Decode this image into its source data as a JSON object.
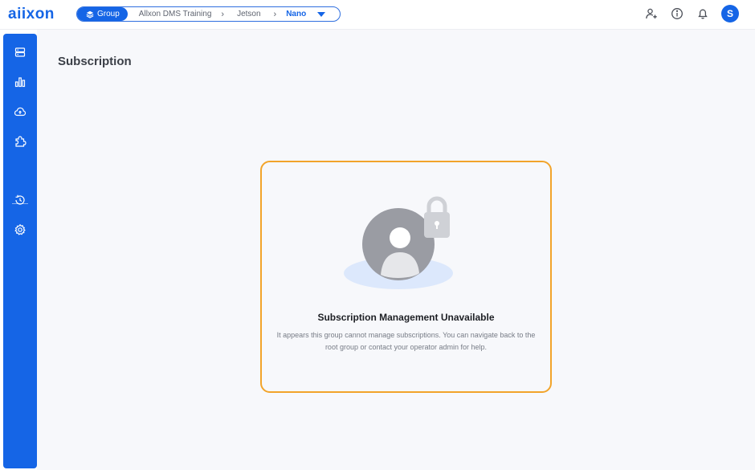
{
  "header": {
    "logo": "aiixon",
    "breadcrumb": {
      "group_label": "Group",
      "items": [
        "Allxon DMS Training",
        "Jetson"
      ],
      "active": "Nano"
    },
    "avatar_initial": "S"
  },
  "sidebar": {
    "items": [
      "devices-icon",
      "dashboard-icon",
      "ota-icon",
      "plugins-icon",
      "alerts-icon",
      "settings-icon"
    ]
  },
  "main": {
    "page_title": "Subscription",
    "empty_state": {
      "title": "Subscription Management Unavailable",
      "description": "It appears this group cannot manage subscriptions. You can navigate back to the root group or contact your operator admin for help."
    }
  },
  "colors": {
    "accent": "#1565e6",
    "card_border": "#f2a42a"
  }
}
